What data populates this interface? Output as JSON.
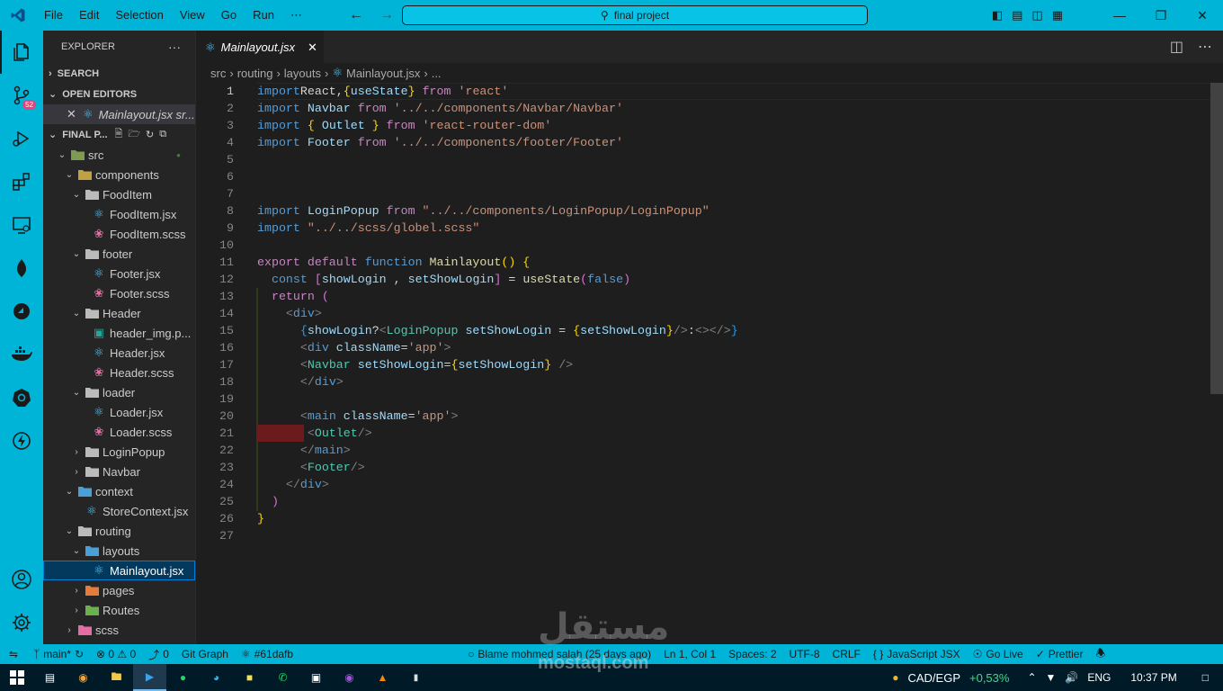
{
  "titlebar": {
    "menu": [
      "File",
      "Edit",
      "Selection",
      "View",
      "Go",
      "Run",
      "⋯"
    ],
    "search_text": "final project"
  },
  "activity_bar": {
    "scm_badge": "52"
  },
  "explorer": {
    "title": "EXPLORER",
    "more": "···",
    "search_section": "SEARCH",
    "open_editors_section": "OPEN EDITORS",
    "open_editor_item": "Mainlayout.jsx sr...",
    "project_section": "FINAL P...",
    "tree": [
      {
        "label": "src",
        "depth": 0,
        "chev": "v",
        "icon": "folder-src",
        "color": "#7e9c4f"
      },
      {
        "label": "components",
        "depth": 1,
        "chev": "v",
        "icon": "folder-components",
        "color": "#c0a244"
      },
      {
        "label": "FoodItem",
        "depth": 2,
        "chev": "v",
        "icon": "folder",
        "color": "#bbbbbb"
      },
      {
        "label": "FoodItem.jsx",
        "depth": 3,
        "chev": "",
        "icon": "react",
        "color": "#4fc3f7"
      },
      {
        "label": "FoodItem.scss",
        "depth": 3,
        "chev": "",
        "icon": "scss",
        "color": "#e36da4"
      },
      {
        "label": "footer",
        "depth": 2,
        "chev": "v",
        "icon": "folder",
        "color": "#bbbbbb"
      },
      {
        "label": "Footer.jsx",
        "depth": 3,
        "chev": "",
        "icon": "react",
        "color": "#4fc3f7"
      },
      {
        "label": "Footer.scss",
        "depth": 3,
        "chev": "",
        "icon": "scss",
        "color": "#e36da4"
      },
      {
        "label": "Header",
        "depth": 2,
        "chev": "v",
        "icon": "folder",
        "color": "#bbbbbb"
      },
      {
        "label": "header_img.p...",
        "depth": 3,
        "chev": "",
        "icon": "image",
        "color": "#26a69a"
      },
      {
        "label": "Header.jsx",
        "depth": 3,
        "chev": "",
        "icon": "react",
        "color": "#4fc3f7"
      },
      {
        "label": "Header.scss",
        "depth": 3,
        "chev": "",
        "icon": "scss",
        "color": "#e36da4"
      },
      {
        "label": "loader",
        "depth": 2,
        "chev": "v",
        "icon": "folder",
        "color": "#bbbbbb"
      },
      {
        "label": "Loader.jsx",
        "depth": 3,
        "chev": "",
        "icon": "react",
        "color": "#4fc3f7"
      },
      {
        "label": "Loader.scss",
        "depth": 3,
        "chev": "",
        "icon": "scss",
        "color": "#e36da4"
      },
      {
        "label": "LoginPopup",
        "depth": 2,
        "chev": ">",
        "icon": "folder",
        "color": "#bbbbbb"
      },
      {
        "label": "Navbar",
        "depth": 2,
        "chev": ">",
        "icon": "folder",
        "color": "#bbbbbb"
      },
      {
        "label": "context",
        "depth": 1,
        "chev": "v",
        "icon": "folder-context",
        "color": "#4a9fd6"
      },
      {
        "label": "StoreContext.jsx",
        "depth": 2,
        "chev": "",
        "icon": "react",
        "color": "#4fc3f7"
      },
      {
        "label": "routing",
        "depth": 1,
        "chev": "v",
        "icon": "folder",
        "color": "#bbbbbb"
      },
      {
        "label": "layouts",
        "depth": 2,
        "chev": "v",
        "icon": "folder-layouts",
        "color": "#4a9fd6"
      },
      {
        "label": "Mainlayout.jsx",
        "depth": 3,
        "chev": "",
        "icon": "react",
        "color": "#4fc3f7",
        "selected": true
      },
      {
        "label": "pages",
        "depth": 2,
        "chev": ">",
        "icon": "folder-pages",
        "color": "#e57c3a"
      },
      {
        "label": "Routes",
        "depth": 2,
        "chev": ">",
        "icon": "folder-routes",
        "color": "#6ab04c"
      },
      {
        "label": "scss",
        "depth": 1,
        "chev": ">",
        "icon": "folder-scss",
        "color": "#e36da4"
      }
    ]
  },
  "tab": {
    "label": "Mainlayout.jsx"
  },
  "breadcrumb": [
    "src",
    "routing",
    "layouts",
    "Mainlayout.jsx",
    "..."
  ],
  "editor": {
    "current_line": 1,
    "lines": [
      [
        [
          "k",
          "import"
        ],
        [
          "",
          "React,"
        ],
        [
          "b1",
          "{"
        ],
        [
          "v",
          "useState"
        ],
        [
          "b1",
          "}"
        ],
        [
          "",
          ""
        ],
        [
          "kc",
          " from"
        ],
        [
          "s",
          " 'react'"
        ]
      ],
      [
        [
          "k",
          "import"
        ],
        [
          "v",
          " Navbar"
        ],
        [
          "kc",
          " from"
        ],
        [
          "s",
          " '../../components/Navbar/Navbar'"
        ]
      ],
      [
        [
          "k",
          "import"
        ],
        [
          "",
          ""
        ],
        [
          "b1",
          " {"
        ],
        [
          "v",
          " Outlet"
        ],
        [
          "b1",
          " }"
        ],
        [
          "kc",
          " from"
        ],
        [
          "s",
          " 'react-router-dom'"
        ]
      ],
      [
        [
          "k",
          "import"
        ],
        [
          "v",
          " Footer"
        ],
        [
          "kc",
          " from"
        ],
        [
          "s",
          " '../../components/footer/Footer'"
        ]
      ],
      [],
      [],
      [],
      [
        [
          "k",
          "import"
        ],
        [
          "v",
          " LoginPopup"
        ],
        [
          "kc",
          " from"
        ],
        [
          "s",
          " \"../../components/LoginPopup/LoginPopup\""
        ]
      ],
      [
        [
          "k",
          "import"
        ],
        [
          "s",
          " \"../../scss/globel.scss\""
        ]
      ],
      [],
      [
        [
          "kc",
          "export"
        ],
        [
          "kc",
          " default"
        ],
        [
          "k",
          " function"
        ],
        [
          "f",
          " Mainlayout"
        ],
        [
          "b1",
          "()"
        ],
        [
          "b1",
          " {"
        ]
      ],
      [
        [
          "",
          "  "
        ],
        [
          "k",
          "const"
        ],
        [
          "b2",
          " ["
        ],
        [
          "v",
          "showLogin"
        ],
        [
          "",
          " , "
        ],
        [
          "v",
          "setShowLogin"
        ],
        [
          "b2",
          "]"
        ],
        [
          "",
          " = "
        ],
        [
          "f",
          "useState"
        ],
        [
          "b2",
          "("
        ],
        [
          "k",
          "false"
        ],
        [
          "b2",
          ")"
        ]
      ],
      [
        [
          "",
          "  "
        ],
        [
          "kc",
          "return"
        ],
        [
          "b2",
          " ("
        ]
      ],
      [
        [
          "",
          "    "
        ],
        [
          "tg",
          "<"
        ],
        [
          "k",
          "div"
        ],
        [
          "tg",
          ">"
        ]
      ],
      [
        [
          "",
          "      "
        ],
        [
          "b3",
          "{"
        ],
        [
          "v",
          "showLogin"
        ],
        [
          "",
          "?"
        ],
        [
          "tg",
          "<"
        ],
        [
          "t",
          "LoginPopup"
        ],
        [
          "v",
          " setShowLogin"
        ],
        [
          "",
          " = "
        ],
        [
          "b1",
          "{"
        ],
        [
          "v",
          "setShowLogin"
        ],
        [
          "b1",
          "}"
        ],
        [
          "tg",
          "/>"
        ],
        [
          "",
          ":"
        ],
        [
          "tg",
          "<></>"
        ],
        [
          "b3",
          "}"
        ]
      ],
      [
        [
          "",
          "      "
        ],
        [
          "tg",
          "<"
        ],
        [
          "k",
          "div"
        ],
        [
          "v",
          " className"
        ],
        [
          "",
          "="
        ],
        [
          "s",
          "'app'"
        ],
        [
          "tg",
          ">"
        ]
      ],
      [
        [
          "",
          "      "
        ],
        [
          "tg",
          "<"
        ],
        [
          "t",
          "Navbar"
        ],
        [
          "v",
          " setShowLogin"
        ],
        [
          "",
          "="
        ],
        [
          "b1",
          "{"
        ],
        [
          "v",
          "setShowLogin"
        ],
        [
          "b1",
          "}"
        ],
        [
          "tg",
          " />"
        ]
      ],
      [
        [
          "",
          "      "
        ],
        [
          "tg",
          "</"
        ],
        [
          "k",
          "div"
        ],
        [
          "tg",
          ">"
        ]
      ],
      [],
      [
        [
          "",
          "      "
        ],
        [
          "tg",
          "<"
        ],
        [
          "k",
          "main"
        ],
        [
          "v",
          " className"
        ],
        [
          "",
          "="
        ],
        [
          "s",
          "'app'"
        ],
        [
          "tg",
          ">"
        ]
      ],
      [
        [
          "",
          "       "
        ],
        [
          "tg",
          "<"
        ],
        [
          "t",
          "Outlet"
        ],
        [
          "tg",
          "/>"
        ]
      ],
      [
        [
          "",
          "      "
        ],
        [
          "tg",
          "</"
        ],
        [
          "k",
          "main"
        ],
        [
          "tg",
          ">"
        ]
      ],
      [
        [
          "",
          "      "
        ],
        [
          "tg",
          "<"
        ],
        [
          "t",
          "Footer"
        ],
        [
          "tg",
          "/>"
        ]
      ],
      [
        [
          "",
          "    "
        ],
        [
          "tg",
          "</"
        ],
        [
          "k",
          "div"
        ],
        [
          "tg",
          ">"
        ]
      ],
      [
        [
          "",
          "  "
        ],
        [
          "b2",
          ")"
        ]
      ],
      [
        [
          "b1",
          "}"
        ]
      ],
      []
    ]
  },
  "statusbar": {
    "branch": "main*",
    "problems": "⊗ 0 ⚠ 0",
    "ports": "0",
    "gitgraph": "Git Graph",
    "commit": "#61dafb",
    "blame": "Blame mohmed salah (25 days ago)",
    "position": "Ln 1, Col 1",
    "spaces": "Spaces: 2",
    "encoding": "UTF-8",
    "eol": "CRLF",
    "language": "JavaScript JSX",
    "golive": "Go Live",
    "prettier": "Prettier"
  },
  "taskbar": {
    "ticker": "CAD/EGP",
    "ticker_change": "+0,53%",
    "lang": "ENG",
    "time": "10:37 PM"
  },
  "watermark": {
    "arabic": "مستقل",
    "latin": "mostaql.com"
  }
}
